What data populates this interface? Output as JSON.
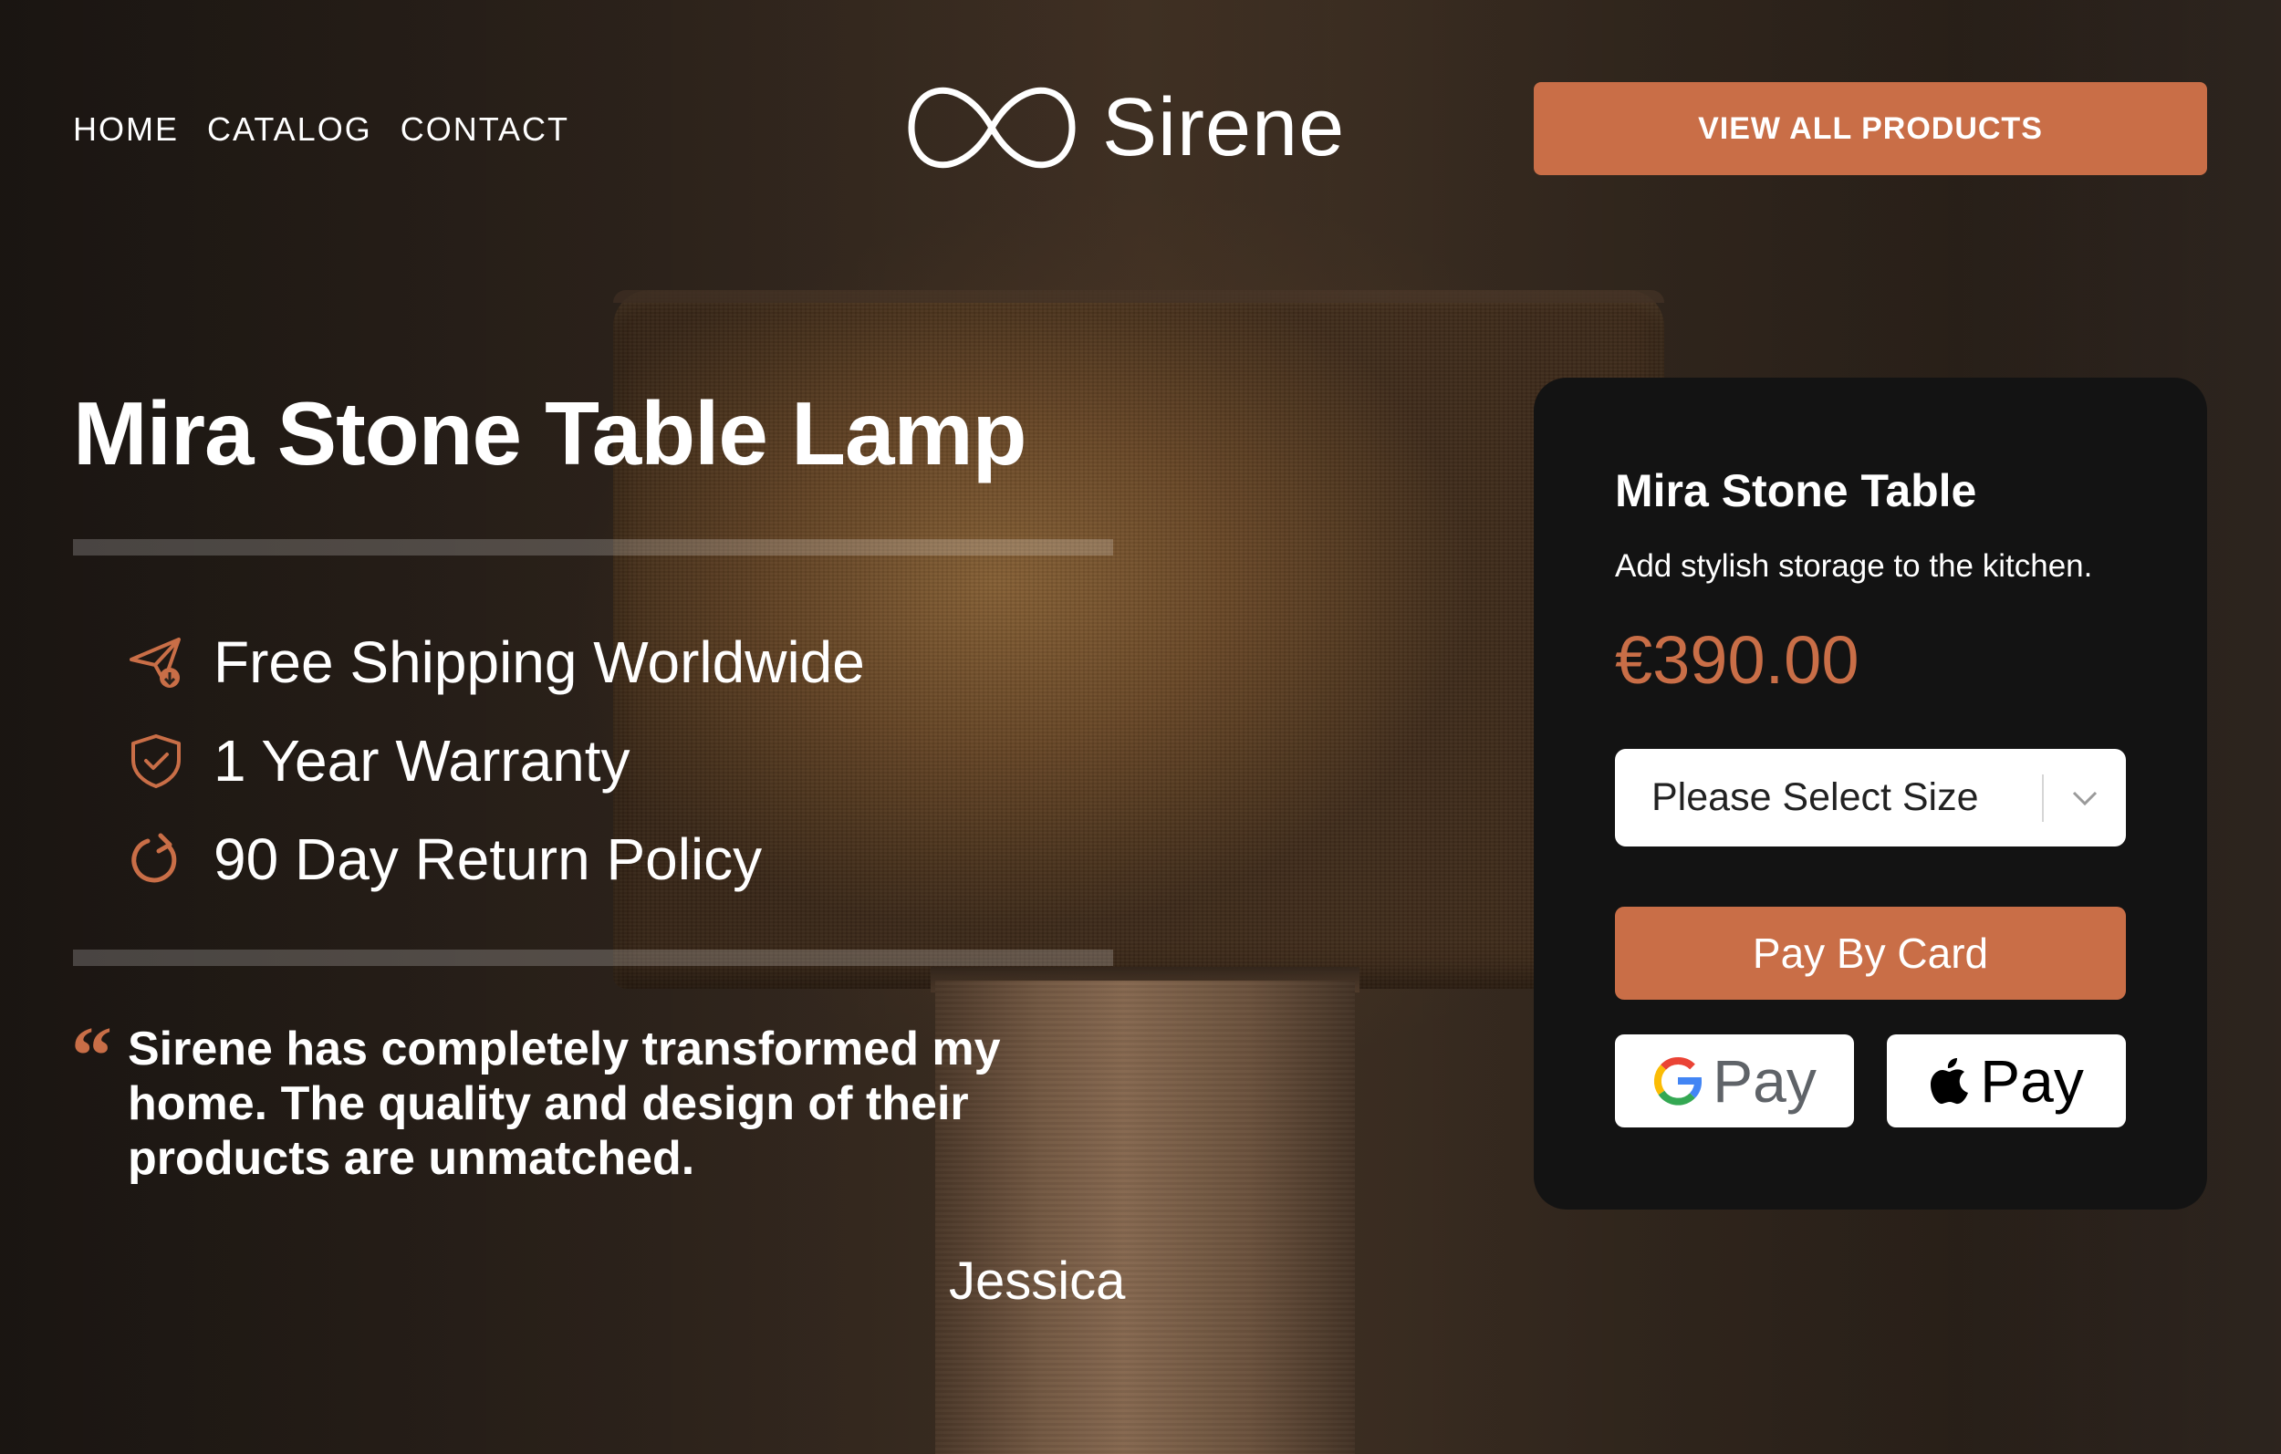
{
  "nav": {
    "items": [
      {
        "label": "HOME"
      },
      {
        "label": "CATALOG"
      },
      {
        "label": "CONTACT"
      }
    ]
  },
  "brand": {
    "name": "Sirene",
    "icon": "infinity-icon"
  },
  "header": {
    "cta_label": "VIEW ALL PRODUCTS"
  },
  "hero": {
    "title": "Mira Stone Table Lamp",
    "features": [
      {
        "icon": "paper-plane-icon",
        "text": "Free Shipping Worldwide"
      },
      {
        "icon": "shield-check-icon",
        "text": "1 Year Warranty"
      },
      {
        "icon": "refresh-icon",
        "text": "90 Day Return Policy"
      }
    ],
    "quote_mark": "“",
    "quote": "Sirene has completely transformed my home. The quality and design of their products are unmatched.",
    "author": "Jessica"
  },
  "product_card": {
    "title": "Mira Stone Table",
    "description": "Add stylish storage to the kitchen.",
    "price": "€390.00",
    "size_select": {
      "selected": "Please Select Size"
    },
    "pay_card_label": "Pay By Card",
    "gpay_label": "Pay",
    "apple_pay_label": "Pay"
  },
  "colors": {
    "accent": "#c96e47",
    "card_bg": "#131313",
    "text": "#ffffff"
  }
}
